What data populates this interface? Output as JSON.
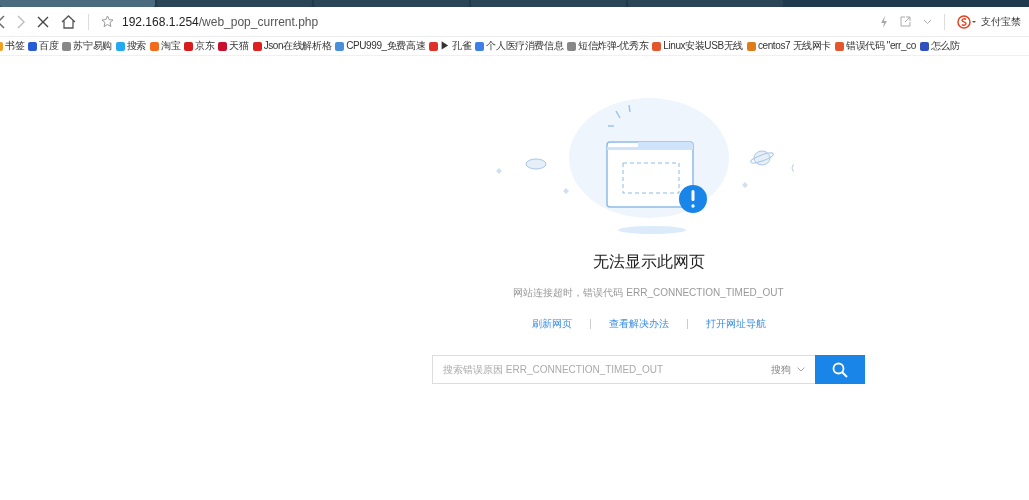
{
  "tabs": [
    {
      "selected": true
    },
    {
      "selected": false
    },
    {
      "selected": false
    },
    {
      "selected": false
    },
    {
      "selected": false
    }
  ],
  "toolbar": {
    "address": "192.168.1.254/web_pop_current.php",
    "loading": true,
    "extension_text": "支付宝禁"
  },
  "bookmarks": [
    {
      "label": "书签",
      "color": "#f0a020"
    },
    {
      "label": "百度",
      "color": "#2a5bd7"
    },
    {
      "label": "苏宁易购",
      "color": "#888888"
    },
    {
      "label": "搜索",
      "color": "#23a8f2"
    },
    {
      "label": "淘宝",
      "color": "#f26b1d"
    },
    {
      "label": "京东",
      "color": "#d71c1e"
    },
    {
      "label": "天猫",
      "color": "#c8102e"
    },
    {
      "label": "Json在线解析格",
      "color": "#e02020"
    },
    {
      "label": "CPU999_免费高速",
      "color": "#4a90d9"
    },
    {
      "label": "▶ 孔雀",
      "color": "#e0302a"
    },
    {
      "label": "个人医疗消费信息",
      "color": "#3d7ee8"
    },
    {
      "label": "短信炸弹-优秀东",
      "color": "#888888"
    },
    {
      "label": "Linux安装USB无线",
      "color": "#e4572e"
    },
    {
      "label": "centos7 无线网卡",
      "color": "#e07b1a"
    },
    {
      "label": "错误代码 \"err_co",
      "color": "#e4572e"
    },
    {
      "label": "怎么防",
      "color": "#3050c0"
    }
  ],
  "error": {
    "title": "无法显示此网页",
    "message": "网站连接超时，错误代码 ERR_CONNECTION_TIMED_OUT",
    "links": [
      "刷新网页",
      "查看解决办法",
      "打开网址导航"
    ],
    "search": {
      "placeholder": "搜索错误原因 ERR_CONNECTION_TIMED_OUT",
      "engine": "搜狗"
    }
  }
}
